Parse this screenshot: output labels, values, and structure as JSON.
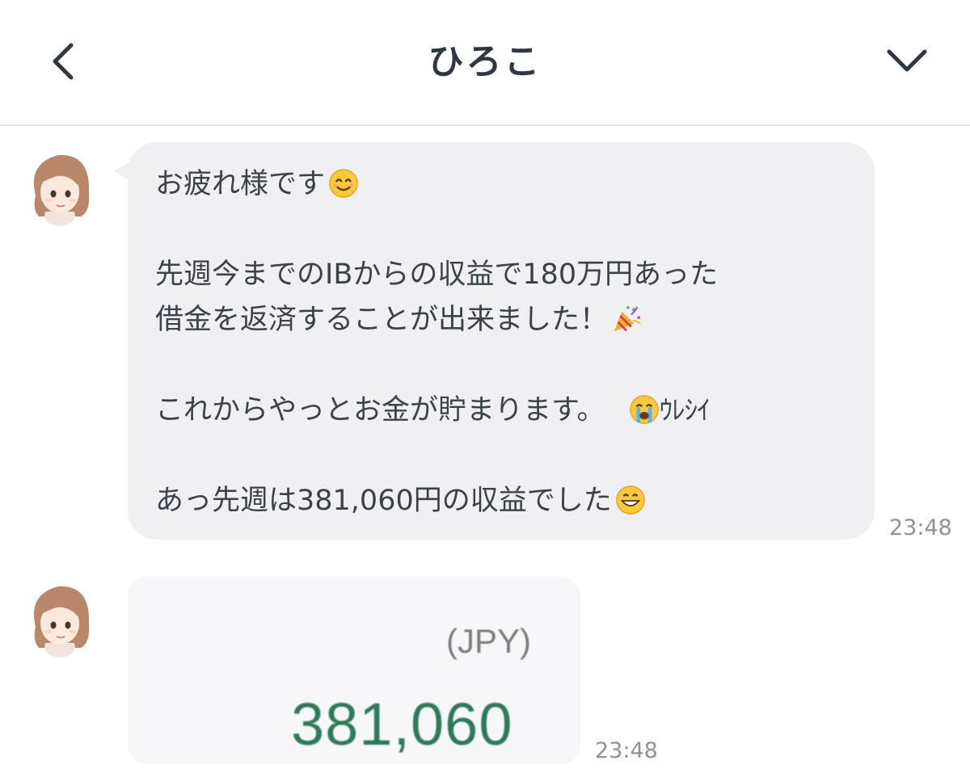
{
  "header": {
    "title": "ひろこ",
    "back_icon": "chevron-left-icon",
    "menu_icon": "chevron-down-icon"
  },
  "messages": [
    {
      "sender_avatar": "avatar-woman-brown-hair",
      "lines": [
        {
          "text": "お疲れ様です",
          "emoji": "smiling-face-icon"
        },
        {
          "text": ""
        },
        {
          "text": "先週今までのIBからの収益で180万円あった"
        },
        {
          "text": "借金を返済することが出来ました！",
          "emoji": "party-popper-icon"
        },
        {
          "text": ""
        },
        {
          "text": "これからやっとお金が貯まります。",
          "emoji": "crying-face-icon",
          "suffix": "ｳﾚｼｲ"
        },
        {
          "text": ""
        },
        {
          "text": "あっ先週は381,060円の収益でした",
          "emoji": "grinning-face-icon"
        }
      ],
      "time": "23:48"
    },
    {
      "sender_avatar": "avatar-woman-brown-hair",
      "image": {
        "currency": "(JPY)",
        "value": "381,060"
      },
      "time": "23:48"
    }
  ],
  "colors": {
    "bubble": "#f0f0f3",
    "text": "#3b4249",
    "value_green": "#2e7a58",
    "timestamp": "#8d9298"
  }
}
